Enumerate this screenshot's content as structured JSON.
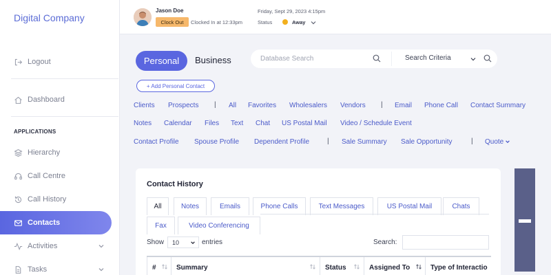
{
  "sidebar": {
    "brand": "Digital Company",
    "logout": "Logout",
    "dashboard": "Dashboard",
    "section": "APPLICATIONS",
    "hierarchy": "Hierarchy",
    "call_centre": "Call Centre",
    "call_history": "Call History",
    "contacts": "Contacts",
    "activities": "Activities",
    "tasks": "Tasks"
  },
  "topbar": {
    "user_name": "Jason Doe",
    "clock_out": "Clock Out",
    "clocked_in": "Clocked In at 12:33pm",
    "datetime": "Friday, Sept 29, 2023 4:15pm",
    "status_label": "Status",
    "status_value": "Away"
  },
  "header": {
    "tab_personal": "Personal",
    "tab_business": "Business",
    "search_placeholder": "Database Search",
    "criteria": "Search Criteria",
    "add_contact": "+ Add Personal Contact"
  },
  "links": {
    "row1": [
      "Clients",
      "Prospects",
      "All",
      "Favorites",
      "Wholesalers",
      "Vendors",
      "Email",
      "Phone Call",
      "Contact Summary"
    ],
    "row2": [
      "Notes",
      "Calendar",
      "Files",
      "Text",
      "Chat",
      "US Postal Mail",
      "Video / Schedule Event"
    ],
    "row3": [
      "Contact Profile",
      "Spouse Profile",
      "Dependent Profile",
      "Sale Summary",
      "Sale Opportunity",
      "Quote"
    ]
  },
  "card": {
    "title": "Contact History",
    "tabs": [
      "All",
      "Notes",
      "Emails",
      "Phone Calls",
      "Text Messages",
      "US Postal Mail",
      "Chats",
      "Fax",
      "Video Conferencing"
    ],
    "show_label": "Show",
    "show_value": "10",
    "entries_label": "entries",
    "search_label": "Search:",
    "columns": [
      "#",
      "Summary",
      "Status",
      "Assigned To",
      "Type of Interactio"
    ]
  },
  "colors": {
    "accent": "#5a66e0",
    "link": "#4a5ac9",
    "clock_out_bg": "#f6b86b",
    "away_dot": "#f2b01e",
    "ad_bg": "#5a6089"
  }
}
